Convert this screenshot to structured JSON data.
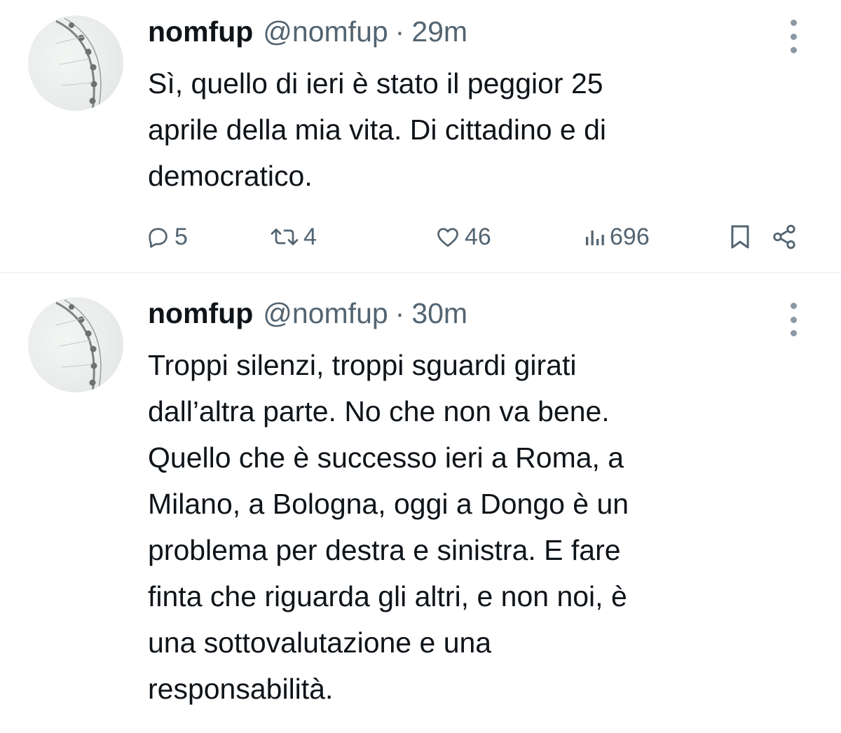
{
  "tweets": [
    {
      "name": "nomfup",
      "handle": "@nomfup",
      "separator": "·",
      "time": "29m",
      "text": "Sì, quello di ieri è stato il peggior 25\naprile della mia vita. Di cittadino e di\ndemocratico.",
      "actions": {
        "replies": "5",
        "reposts": "4",
        "likes": "46",
        "views": "696"
      }
    },
    {
      "name": "nomfup",
      "handle": "@nomfup",
      "separator": "·",
      "time": "30m",
      "text": "Troppi silenzi, troppi sguardi girati\ndall’altra parte. No che non va bene.\nQuello che è successo ieri a Roma, a\nMilano, a Bologna, oggi a Dongo è un\nproblema per destra e sinistra. E fare\nfinta che riguarda gli altri, e non noi, è\nuna sottovalutazione e una\nresponsabilità."
    }
  ],
  "icons": {
    "avatar": "ferris-wheel-image",
    "more": "more-vertical-icon",
    "reply": "reply-icon",
    "repost": "repost-icon",
    "like": "heart-icon",
    "views": "views-icon",
    "bookmark": "bookmark-icon",
    "share": "share-icon"
  },
  "colors": {
    "text": "#0f1419",
    "secondary": "#536471",
    "divider": "#eff3f4"
  }
}
